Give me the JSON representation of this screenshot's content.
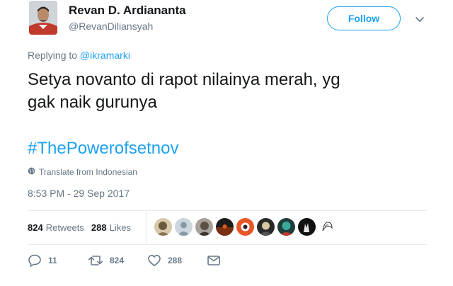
{
  "author": {
    "name": "Revan D. Ardiananta",
    "handle": "@RevanDiliansyah"
  },
  "follow_label": "Follow",
  "replying": {
    "prefix": "Replying to ",
    "target": "@ikramarki"
  },
  "tweet": {
    "text_line1": "Setya novanto di rapot nilainya merah, yg",
    "text_line2": "gak naik gurunya",
    "hashtag": "#ThePowerofsetnov"
  },
  "translate_label": "Translate from Indonesian",
  "timestamp": "8:53 PM - 29 Sep 2017",
  "stats": {
    "retweets_count": "824",
    "retweets_label": "Retweets",
    "likes_count": "288",
    "likes_label": "Likes"
  },
  "actions": {
    "reply_count": "11",
    "retweet_count": "824",
    "like_count": "288"
  },
  "colors": {
    "accent": "#1da1f2",
    "muted": "#657786",
    "text": "#14171a",
    "border": "#e6ecf0"
  },
  "icons": [
    "chevron-down-icon",
    "globe-icon",
    "reply-icon",
    "retweet-icon",
    "heart-icon",
    "envelope-icon"
  ]
}
